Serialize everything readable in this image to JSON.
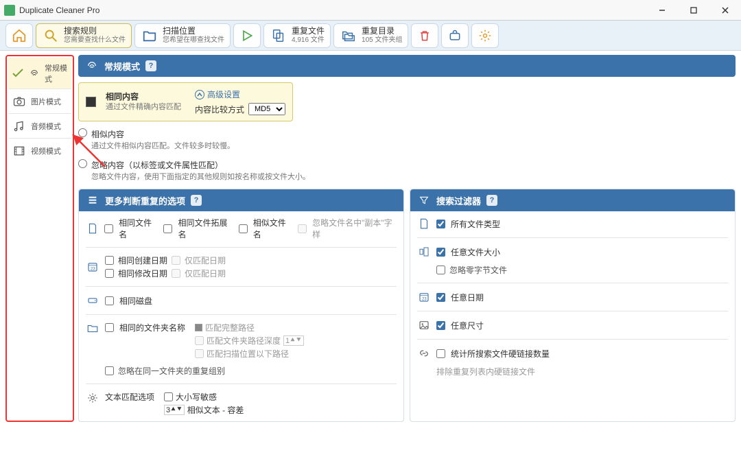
{
  "app": {
    "title": "Duplicate Cleaner Pro"
  },
  "toolbar": {
    "home": "主页",
    "rules": {
      "t1": "搜索规则",
      "t2": "您需要查找什么文件"
    },
    "locations": {
      "t1": "扫描位置",
      "t2": "您希望在哪查找文件"
    },
    "go": "开始",
    "dupfiles": {
      "t1": "重复文件",
      "t2": "4,916 文件"
    },
    "dupfolders": {
      "t1": "重复目录",
      "t2": "105 文件夹组"
    }
  },
  "sidebar": {
    "modes": [
      {
        "label": "常规模式"
      },
      {
        "label": "图片模式"
      },
      {
        "label": "音频模式"
      },
      {
        "label": "视频模式"
      }
    ]
  },
  "regular": {
    "title": "常规模式",
    "same_content_title": "相同内容",
    "same_content_desc": "通过文件精确内容匹配",
    "advanced": "高级设置",
    "compare_label": "内容比较方式",
    "compare_value": "MD5",
    "similar_title": "相似内容",
    "similar_desc": "通过文件相似内容匹配。文件较多时较慢。",
    "ignore_title": "忽略内容（以标签或文件属性匹配）",
    "ignore_desc": "忽略文件内容，使用下面指定的其他规则如按名称或按文件大小。"
  },
  "more": {
    "title": "更多判断重复的选项",
    "same_name": "相同文件名",
    "same_ext": "相同文件拓展名",
    "similar_name": "相似文件名",
    "ignore_copy_suffix": "忽略文件名中\"副本\"字样",
    "same_created": "相同创建日期",
    "same_modified": "相同修改日期",
    "only_date": "仅匹配日期",
    "only_date2": "仅匹配日期",
    "same_drive": "相同磁盘",
    "same_folder_name": "相同的文件夹名称",
    "match_full_path": "匹配完整路径",
    "match_folder_depth": "匹配文件夹路径深度",
    "match_scan_below": "匹配扫描位置以下路径",
    "ignore_same_folder_dup": "忽略在同一文件夹的重复组别",
    "text_match_options": "文本匹配选项",
    "case_sensitive": "大小写敏感",
    "similar_text_tolerant": "相似文本 - 容差",
    "depth_value": "1",
    "tolerant_value": "3"
  },
  "filters": {
    "title": "搜索过滤器",
    "all_types": "所有文件类型",
    "any_size": "任意文件大小",
    "ignore_zero": "忽略零字节文件",
    "any_date": "任意日期",
    "any_dim": "任意尺寸",
    "count_hardlinks": "统计所搜索文件硬链接数量",
    "exclude_hardlinks": "排除重复列表内硬链接文件"
  }
}
